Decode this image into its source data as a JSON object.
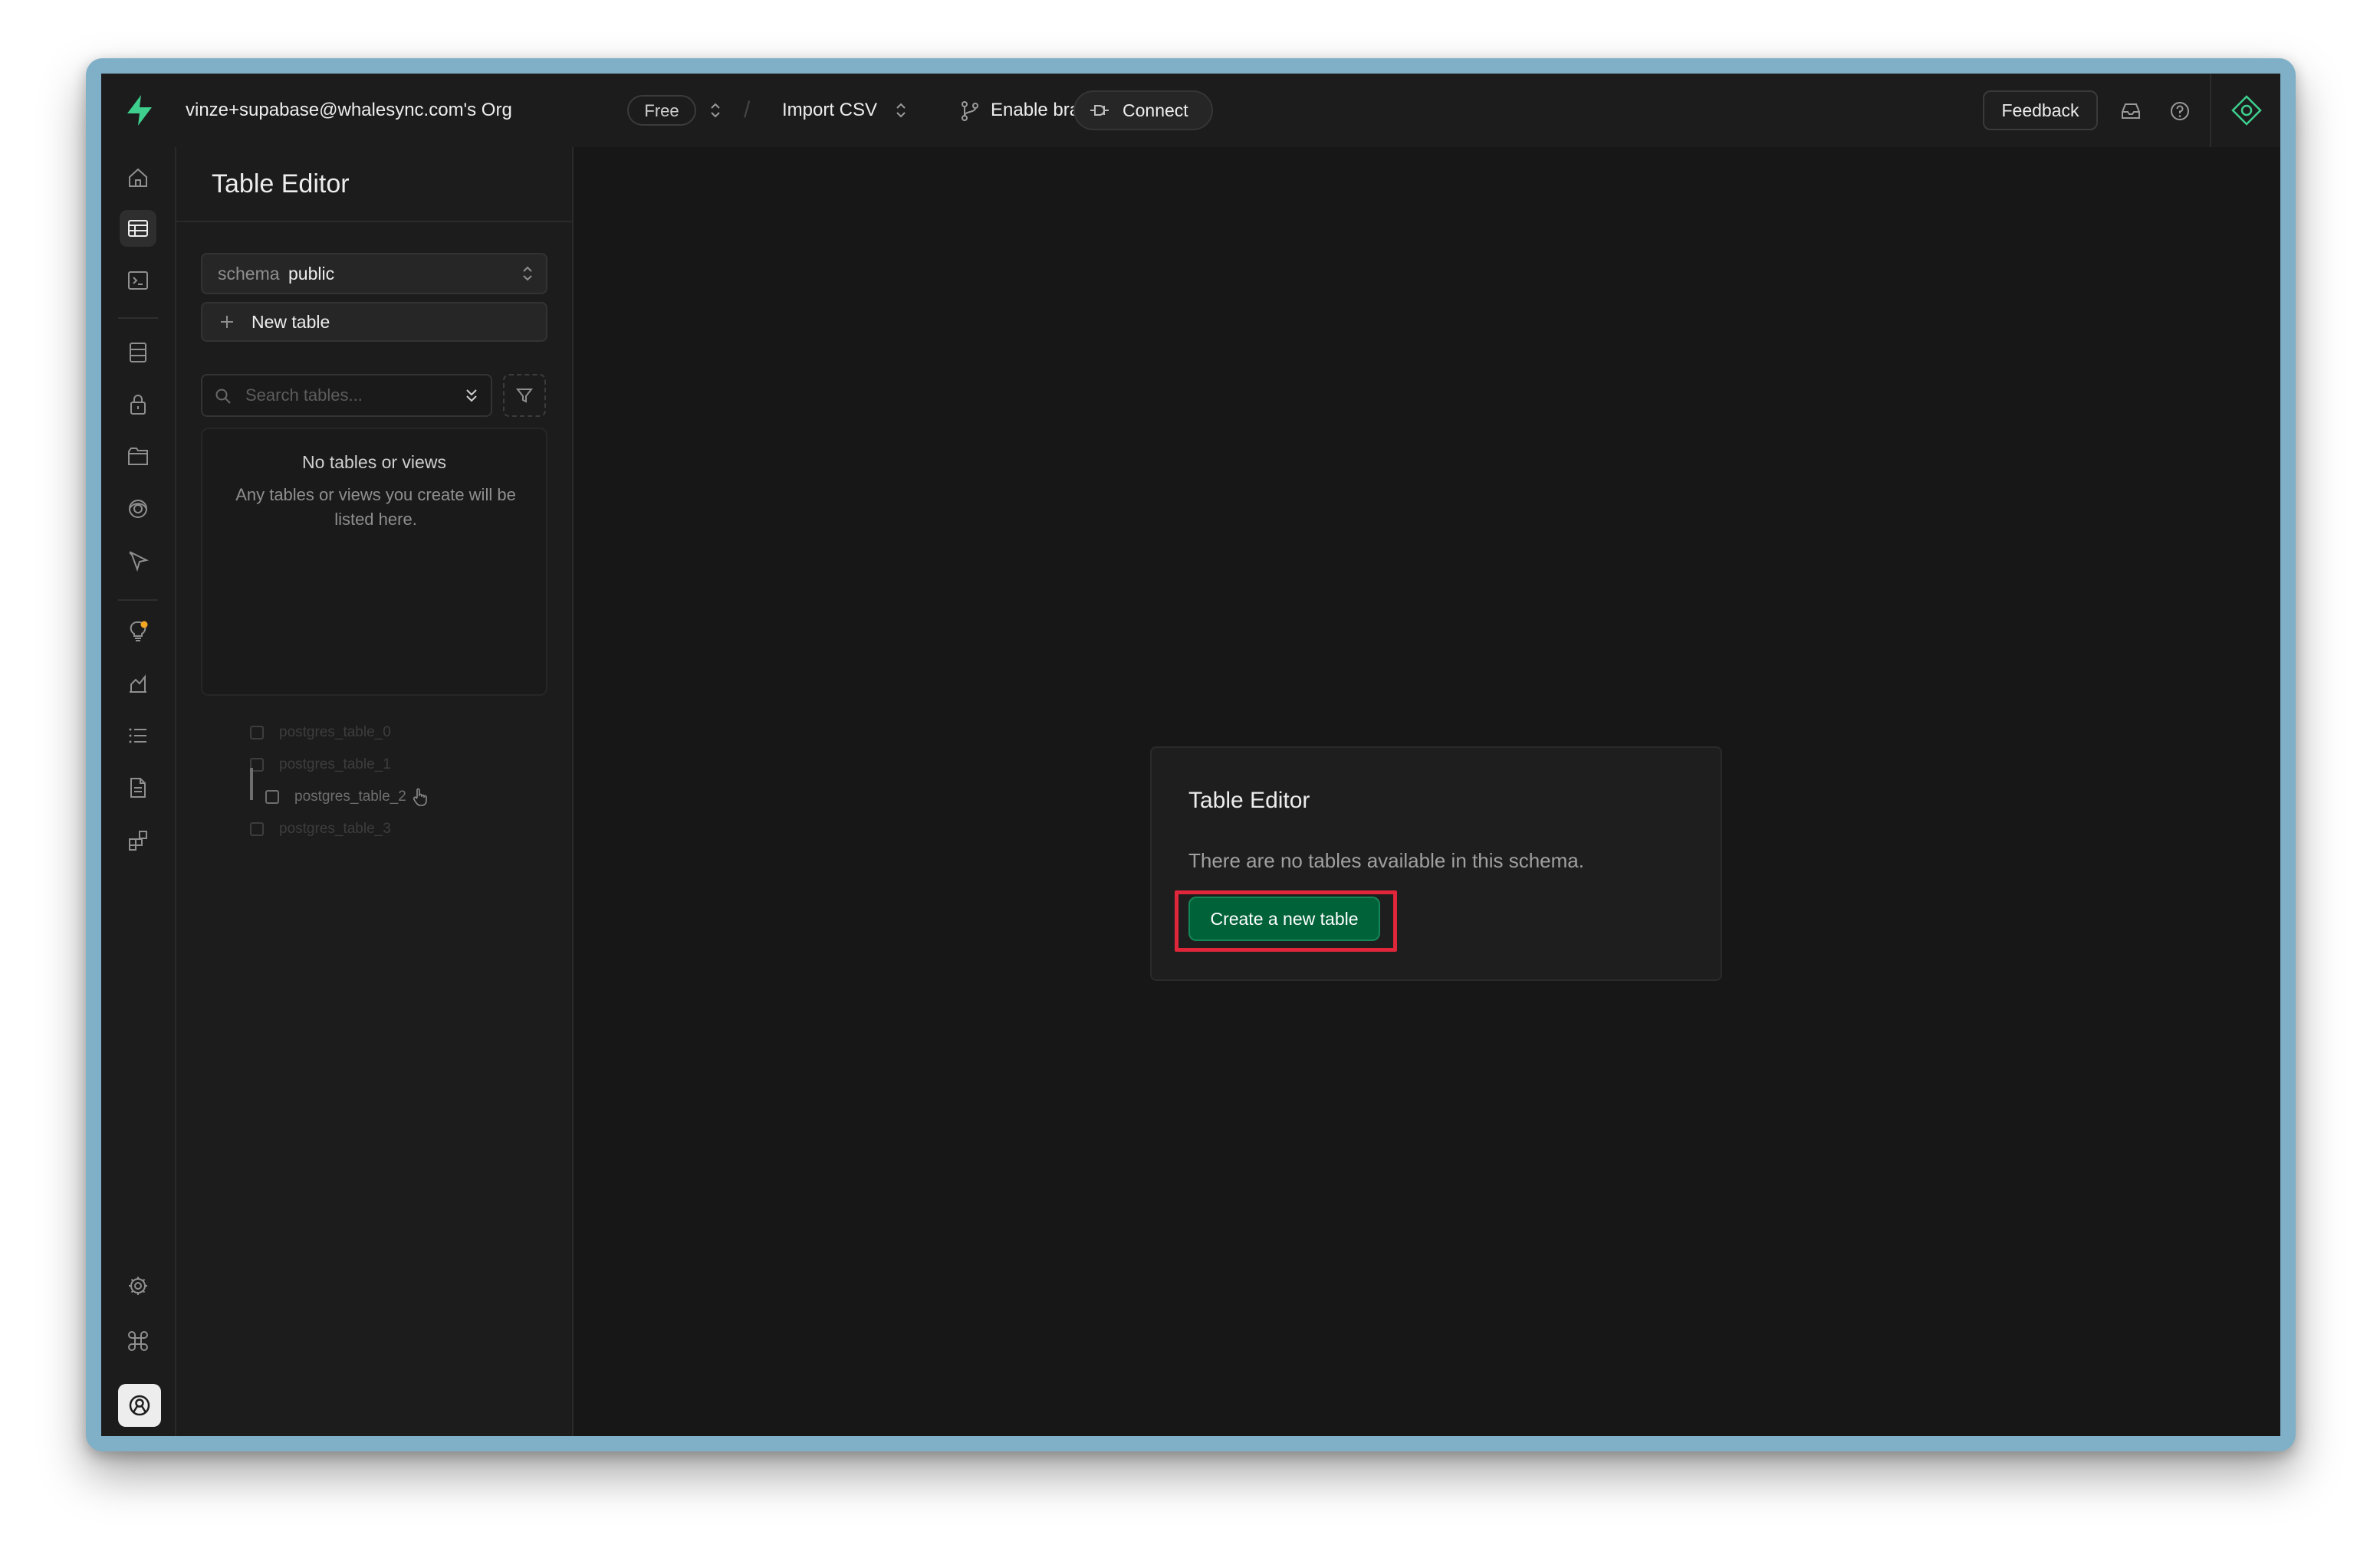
{
  "topbar": {
    "org_name": "vinze+supabase@whalesync.com's Org",
    "plan_badge": "Free",
    "project_name": "Import CSV",
    "branching_label": "Enable branching",
    "connect_label": "Connect",
    "feedback_label": "Feedback"
  },
  "sidebar_nav": {
    "items": [
      "home-icon",
      "table-editor-icon",
      "sql-editor-icon",
      "database-icon",
      "auth-icon",
      "storage-icon",
      "realtime-icon",
      "edge-functions-icon",
      "advisors-icon",
      "reports-icon",
      "logs-icon",
      "api-docs-icon",
      "integrations-icon",
      "settings-icon",
      "command-icon",
      "avatar-icon",
      "collapse-icon"
    ],
    "active": "table-editor-icon"
  },
  "panel": {
    "title": "Table Editor",
    "schema_label": "schema",
    "schema_value": "public",
    "new_table_label": "New table",
    "search_placeholder": "Search tables...",
    "empty_title": "No tables or views",
    "empty_desc": "Any tables or views you create will be listed here.",
    "ghost_rows": [
      "postgres_table_0",
      "postgres_table_1",
      "postgres_table_2",
      "postgres_table_3"
    ]
  },
  "main": {
    "card_title": "Table Editor",
    "card_desc": "There are no tables available in this schema.",
    "create_button": "Create a new table"
  },
  "colors": {
    "background": "#171717",
    "accent": "#3ecf8e",
    "primary_button": "#006239",
    "highlight": "#e0263a",
    "notification_dot": "#f5a623"
  }
}
